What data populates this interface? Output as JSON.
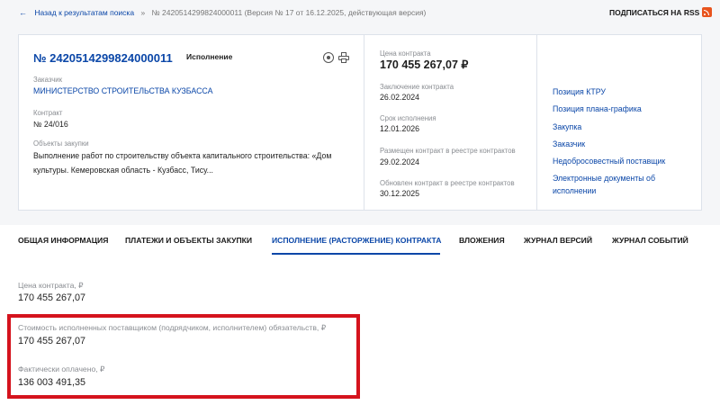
{
  "breadcrumb": {
    "back_label": "Назад к результатам поиска",
    "separator": "»",
    "current": "№ 2420514299824000011 (Версия № 17 от 16.12.2025, действующая версия)"
  },
  "header": {
    "subscribe_label": "ПОДПИСАТЬСЯ НА RSS",
    "rss_icon": "rss-icon"
  },
  "contract": {
    "number": "№ 2420514299824000011",
    "status": "Исполнение",
    "icons": [
      "target-icon",
      "print-icon"
    ],
    "customer_label": "Заказчик",
    "customer_value": "МИНИСТЕРСТВО СТРОИТЕЛЬСТВА КУЗБАССА",
    "contract_label": "Контракт",
    "contract_value": "№ 24/016",
    "objects_label": "Объекты закупки",
    "objects_value": "Выполнение работ по строительству объекта капитального строительства: «Дом культуры. Кемеровская область - Кузбасс, Тису..."
  },
  "summary": {
    "price_label": "Цена контракта",
    "price_value": "170 455 267,07 ₽",
    "conclusion_label": "Заключение контракта",
    "conclusion_value": "26.02.2024",
    "term_label": "Срок исполнения",
    "term_value": "12.01.2026",
    "placed_label": "Размещен контракт в реестре контрактов",
    "placed_value": "29.02.2024",
    "updated_label": "Обновлен контракт в реестре контрактов",
    "updated_value": "30.12.2025"
  },
  "links": [
    "Позиция КТРУ",
    "Позиция плана-графика",
    "Закупка",
    "Заказчик",
    "Недобросовестный поставщик",
    "Электронные документы об исполнении"
  ],
  "tabs": [
    "ОБЩАЯ ИНФОРМАЦИЯ",
    "ПЛАТЕЖИ И ОБЪЕКТЫ ЗАКУПКИ",
    "ИСПОЛНЕНИЕ (РАСТОРЖЕНИЕ) КОНТРАКТА",
    "ВЛОЖЕНИЯ",
    "ЖУРНАЛ ВЕРСИЙ",
    "ЖУРНАЛ СОБЫТИЙ"
  ],
  "active_tab": "ИСПОЛНЕНИЕ (РАСТОРЖЕНИЕ) КОНТРАКТА",
  "execution": {
    "price_label": "Цена контракта, ₽",
    "price_value": "170 455 267,07",
    "fulfilled_label": "Стоимость исполненных поставщиком (подрядчиком, исполнителем) обязательств, ₽",
    "fulfilled_value": "170 455 267,07",
    "paid_label": "Фактически оплачено, ₽",
    "paid_value": "136 003 491,35"
  },
  "colors": {
    "accent": "#0b47a8",
    "highlight": "#d5131d",
    "background": "#f5f6f8"
  }
}
